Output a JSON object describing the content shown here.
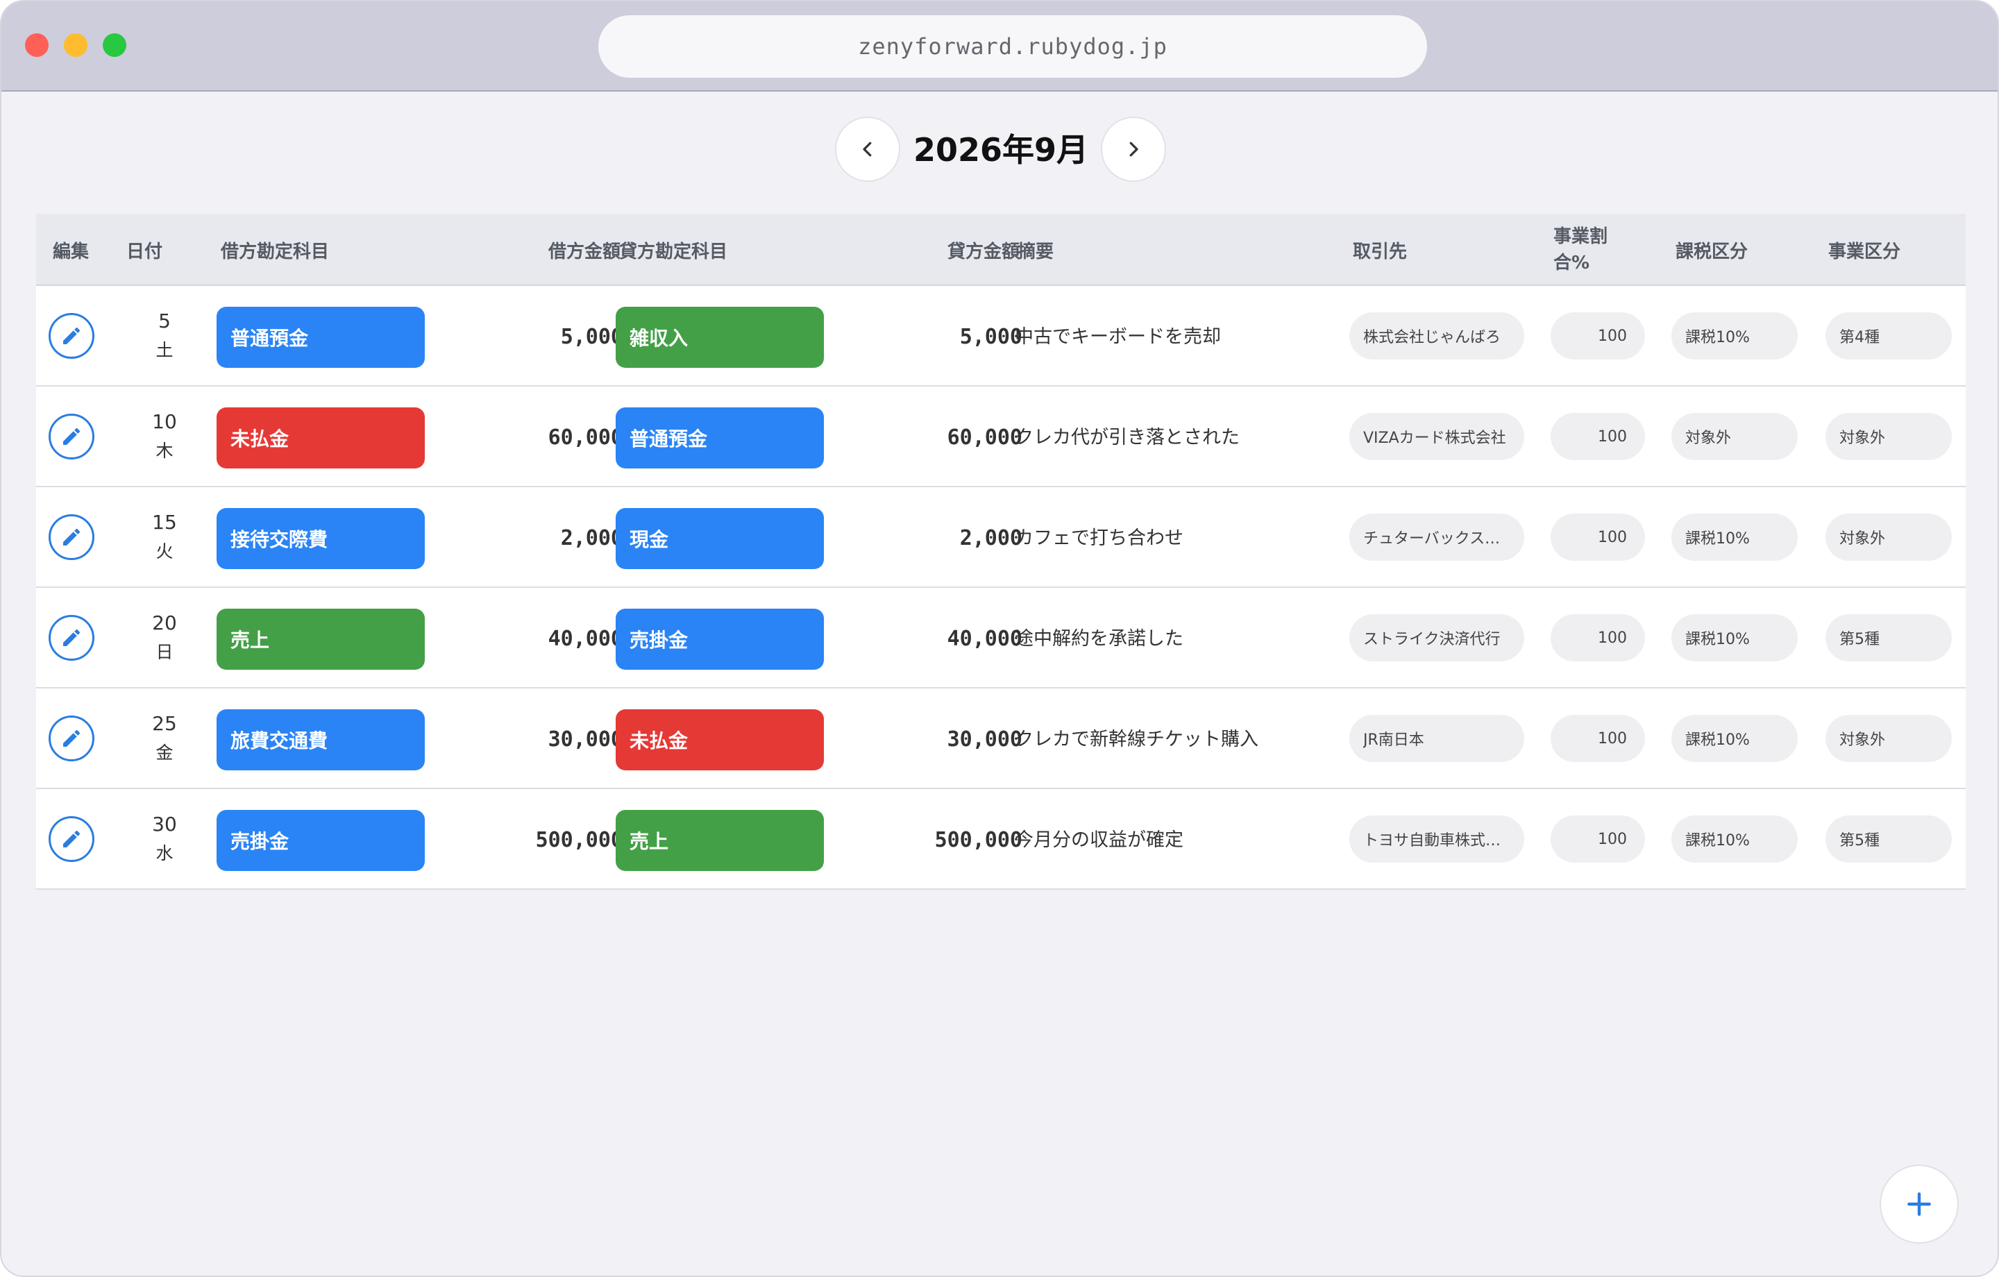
{
  "browser": {
    "url": "zenyforward.rubydog.jp"
  },
  "month_nav": {
    "title": "2026年9月",
    "prev_icon": "chevron-left-icon",
    "next_icon": "chevron-right-icon"
  },
  "colors": {
    "blue": "#2a84f5",
    "green": "#43a047",
    "red": "#e53935",
    "accent": "#2a7de1"
  },
  "table": {
    "headers": {
      "edit": "編集",
      "date": "日付",
      "debit_account": "借方勘定科目",
      "debit_amount": "借方金額",
      "credit_account": "貸方勘定科目",
      "credit_amount": "貸方金額",
      "summary": "摘要",
      "partner": "取引先",
      "biz_ratio_line1": "事業割",
      "biz_ratio_line2": "合%",
      "tax_class": "課税区分",
      "biz_class": "事業区分"
    },
    "rows": [
      {
        "day": "5",
        "weekday": "土",
        "debit": "普通預金",
        "debit_color": "blue",
        "debit_amount": "5,000",
        "credit": "雑収入",
        "credit_color": "green",
        "credit_amount": "5,000",
        "summary": "中古でキーボードを売却",
        "partner": "株式会社じゃんばろ",
        "ratio": "100",
        "tax": "課税10%",
        "biz": "第4種"
      },
      {
        "day": "10",
        "weekday": "木",
        "debit": "未払金",
        "debit_color": "red",
        "debit_amount": "60,000",
        "credit": "普通預金",
        "credit_color": "blue",
        "credit_amount": "60,000",
        "summary": "クレカ代が引き落とされた",
        "partner": "VIZAカード株式会社",
        "ratio": "100",
        "tax": "対象外",
        "biz": "対象外"
      },
      {
        "day": "15",
        "weekday": "火",
        "debit": "接待交際費",
        "debit_color": "blue",
        "debit_amount": "2,000",
        "credit": "現金",
        "credit_color": "blue",
        "credit_amount": "2,000",
        "summary": "カフェで打ち合わせ",
        "partner": "チュターバックス…",
        "ratio": "100",
        "tax": "課税10%",
        "biz": "対象外"
      },
      {
        "day": "20",
        "weekday": "日",
        "debit": "売上",
        "debit_color": "green",
        "debit_amount": "40,000",
        "credit": "売掛金",
        "credit_color": "blue",
        "credit_amount": "40,000",
        "summary": "途中解約を承諾した",
        "partner": "ストライク決済代行",
        "ratio": "100",
        "tax": "課税10%",
        "biz": "第5種"
      },
      {
        "day": "25",
        "weekday": "金",
        "debit": "旅費交通費",
        "debit_color": "blue",
        "debit_amount": "30,000",
        "credit": "未払金",
        "credit_color": "red",
        "credit_amount": "30,000",
        "summary": "クレカで新幹線チケット購入",
        "partner": "JR南日本",
        "ratio": "100",
        "tax": "課税10%",
        "biz": "対象外"
      },
      {
        "day": "30",
        "weekday": "水",
        "debit": "売掛金",
        "debit_color": "blue",
        "debit_amount": "500,000",
        "credit": "売上",
        "credit_color": "green",
        "credit_amount": "500,000",
        "summary": "今月分の収益が確定",
        "partner": "トヨサ自動車株式…",
        "ratio": "100",
        "tax": "課税10%",
        "biz": "第5種"
      }
    ]
  },
  "fab": {
    "icon": "plus-icon"
  }
}
